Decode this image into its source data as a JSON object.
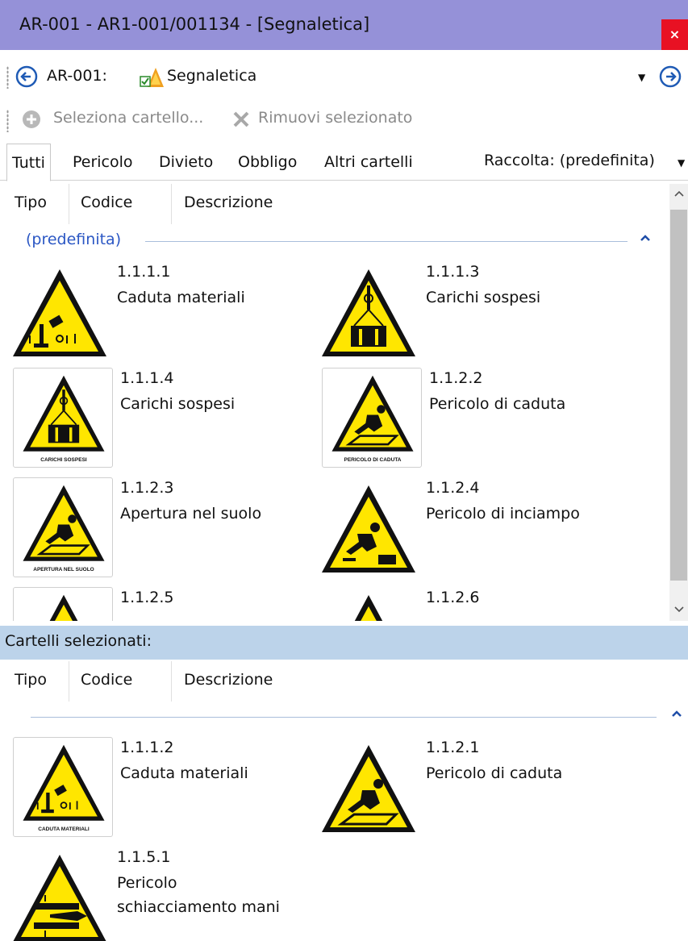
{
  "window": {
    "title": "AR-001 - AR1-001/001134 - [Segnaletica]",
    "close_label": "×"
  },
  "nav": {
    "id_label": "AR-001:",
    "field_value": "Segnaletica"
  },
  "toolbar": {
    "select_label": "Seleziona cartello...",
    "remove_label": "Rimuovi selezionato"
  },
  "tabs": [
    {
      "label": "Tutti",
      "active": true
    },
    {
      "label": "Pericolo",
      "active": false
    },
    {
      "label": "Divieto",
      "active": false
    },
    {
      "label": "Obbligo",
      "active": false
    },
    {
      "label": "Altri cartelli",
      "active": false
    }
  ],
  "raccolta_label": "Raccolta: (predefinita)",
  "columns": [
    "Tipo",
    "Codice",
    "Descrizione"
  ],
  "upper": {
    "group_name": "(predefinita)",
    "items": [
      {
        "code": "1.1.1.1",
        "description": "Caduta materiali",
        "icon": "falling-materials-icon"
      },
      {
        "code": "1.1.1.3",
        "description": "Carichi sospesi",
        "icon": "suspended-loads-icon"
      },
      {
        "code": "1.1.1.4",
        "description": "Carichi sospesi",
        "icon": "suspended-loads-icon",
        "caption": "CARICHI SOSPESI"
      },
      {
        "code": "1.1.2.2",
        "description": "Pericolo di caduta",
        "icon": "fall-hazard-icon",
        "caption": "PERICOLO DI CADUTA"
      },
      {
        "code": "1.1.2.3",
        "description": "Apertura nel suolo",
        "icon": "floor-opening-icon",
        "caption": "APERTURA NEL SUOLO"
      },
      {
        "code": "1.1.2.4",
        "description": "Pericolo di inciampo",
        "icon": "trip-hazard-icon"
      },
      {
        "code": "1.1.2.5",
        "description": "",
        "icon": "warning-triangle-icon"
      },
      {
        "code": "1.1.2.6",
        "description": "",
        "icon": "warning-triangle-icon"
      }
    ]
  },
  "selected": {
    "header": "Cartelli selezionati:",
    "items": [
      {
        "code": "1.1.1.2",
        "description": "Caduta materiali",
        "icon": "falling-materials-icon",
        "caption": "CADUTA MATERIALI"
      },
      {
        "code": "1.1.2.1",
        "description": "Pericolo di caduta",
        "icon": "fall-hazard-icon"
      },
      {
        "code": "1.1.5.1",
        "description_lines": [
          "Pericolo",
          "schiacciamento mani"
        ],
        "icon": "hand-crush-icon"
      }
    ]
  },
  "colors": {
    "titlebar": "#9591d8",
    "close": "#e81123",
    "sign_yellow": "#ffe600",
    "selected_header": "#bcd3ea",
    "group_text": "#2b57c4"
  }
}
